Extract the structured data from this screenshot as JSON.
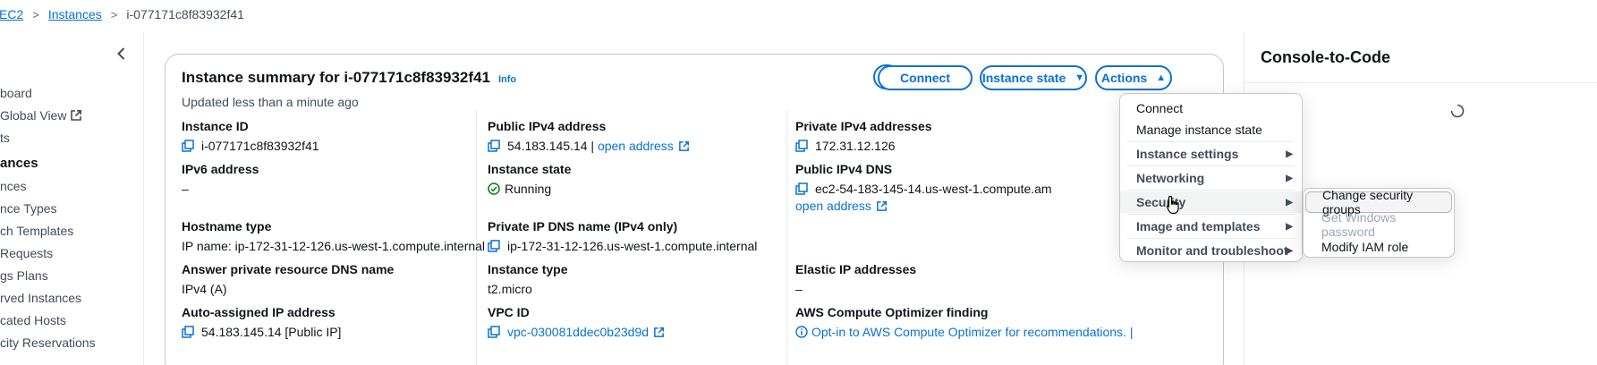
{
  "breadcrumb": {
    "items": [
      "EC2",
      "Instances"
    ],
    "current": "i-077171c8f83932f41"
  },
  "sidebar": {
    "items": [
      {
        "label": "board",
        "type": "item"
      },
      {
        "label": "Global View",
        "type": "item",
        "external": true
      },
      {
        "label": "ts",
        "type": "item"
      },
      {
        "label": "ances",
        "type": "header"
      },
      {
        "label": "nces",
        "type": "item"
      },
      {
        "label": "nce Types",
        "type": "item"
      },
      {
        "label": "ch Templates",
        "type": "item"
      },
      {
        "label": "Requests",
        "type": "item"
      },
      {
        "label": "gs Plans",
        "type": "item"
      },
      {
        "label": "rved Instances",
        "type": "item"
      },
      {
        "label": "cated Hosts",
        "type": "item"
      },
      {
        "label": "city Reservations",
        "type": "item"
      }
    ]
  },
  "summary": {
    "title": "Instance summary for i-077171c8f83932f41",
    "info": "Info",
    "updated": "Updated less than a minute ago",
    "buttons": {
      "connect": "Connect",
      "instance_state": "Instance state",
      "actions": "Actions"
    },
    "fields": {
      "instance_id": {
        "label": "Instance ID",
        "value": "i-077171c8f83932f41"
      },
      "ipv6": {
        "label": "IPv6 address",
        "value": "–"
      },
      "hostname_type": {
        "label": "Hostname type",
        "value": "IP name: ip-172-31-12-126.us-west-1.compute.internal"
      },
      "answer_dns": {
        "label": "Answer private resource DNS name",
        "value": "IPv4 (A)"
      },
      "auto_ip": {
        "label": "Auto-assigned IP address",
        "value": "54.183.145.14 [Public IP]"
      },
      "public_ipv4": {
        "label": "Public IPv4 address",
        "value": "54.183.145.14 |",
        "link": "open address"
      },
      "instance_state": {
        "label": "Instance state",
        "value": "Running"
      },
      "private_dns": {
        "label": "Private IP DNS name (IPv4 only)",
        "value": "ip-172-31-12-126.us-west-1.compute.internal"
      },
      "instance_type": {
        "label": "Instance type",
        "value": "t2.micro"
      },
      "vpc_id": {
        "label": "VPC ID",
        "value": "vpc-030081ddec0b23d9d"
      },
      "private_ipv4": {
        "label": "Private IPv4 addresses",
        "value": "172.31.12.126"
      },
      "public_dns": {
        "label": "Public IPv4 DNS",
        "value": "ec2-54-183-145-14.us-west-1.compute.am",
        "link": "open address"
      },
      "elastic_ip": {
        "label": "Elastic IP addresses",
        "value": "–"
      },
      "optimizer": {
        "label": "AWS Compute Optimizer finding",
        "value": "Opt-in to AWS Compute Optimizer for recommendations. |"
      }
    }
  },
  "actions_menu": {
    "items": [
      {
        "label": "Connect",
        "group": false
      },
      {
        "label": "Manage instance state",
        "group": false
      },
      {
        "label": "Instance settings",
        "group": true
      },
      {
        "label": "Networking",
        "group": true
      },
      {
        "label": "Security",
        "group": true
      },
      {
        "label": "Image and templates",
        "group": true
      },
      {
        "label": "Monitor and troubleshoot",
        "group": true
      }
    ]
  },
  "security_submenu": {
    "items": [
      {
        "label": "Change security groups",
        "disabled": false
      },
      {
        "label": "Get Windows password",
        "disabled": true
      },
      {
        "label": "Modify IAM role",
        "disabled": false
      }
    ]
  },
  "console_panel": {
    "title": "Console-to-Code"
  },
  "colors": {
    "link": "#0972d3",
    "success": "#037f0c",
    "text": "#0f141a",
    "border": "#c6c6cd"
  }
}
